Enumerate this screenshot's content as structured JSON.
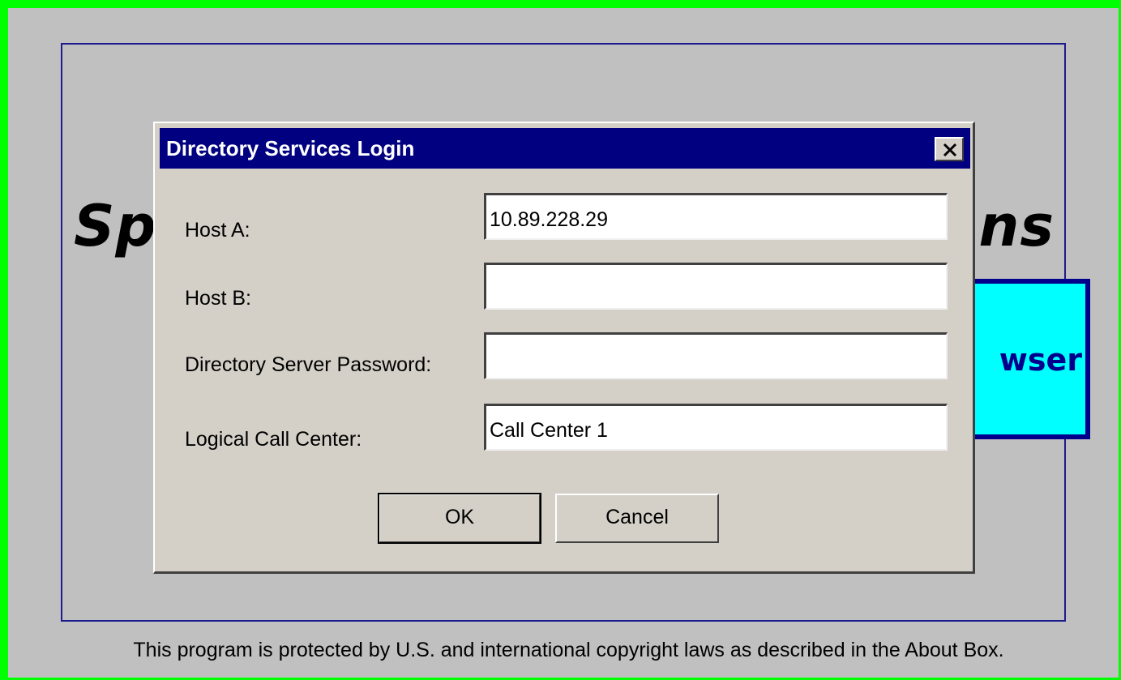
{
  "splash": {
    "title_left": "Sp",
    "title_right": "ns",
    "browser_button_label": "wser",
    "copyright": "This program is protected by U.S. and international copyright laws as described in the About Box."
  },
  "dialog": {
    "title": "Directory Services Login",
    "close_icon": "close-icon",
    "fields": {
      "host_a": {
        "label": "Host A:",
        "value": "10.89.228.29"
      },
      "host_b": {
        "label": "Host B:",
        "value": ""
      },
      "password": {
        "label": "Directory Server Password:",
        "value": ""
      },
      "call_center": {
        "label": "Logical Call Center:",
        "value": "Call Center 1"
      }
    },
    "buttons": {
      "ok": "OK",
      "cancel": "Cancel"
    }
  },
  "colors": {
    "frame_border": "#00ff00",
    "titlebar": "#000080",
    "browser_button_bg": "#00ffff",
    "browser_button_border": "#00008b"
  }
}
